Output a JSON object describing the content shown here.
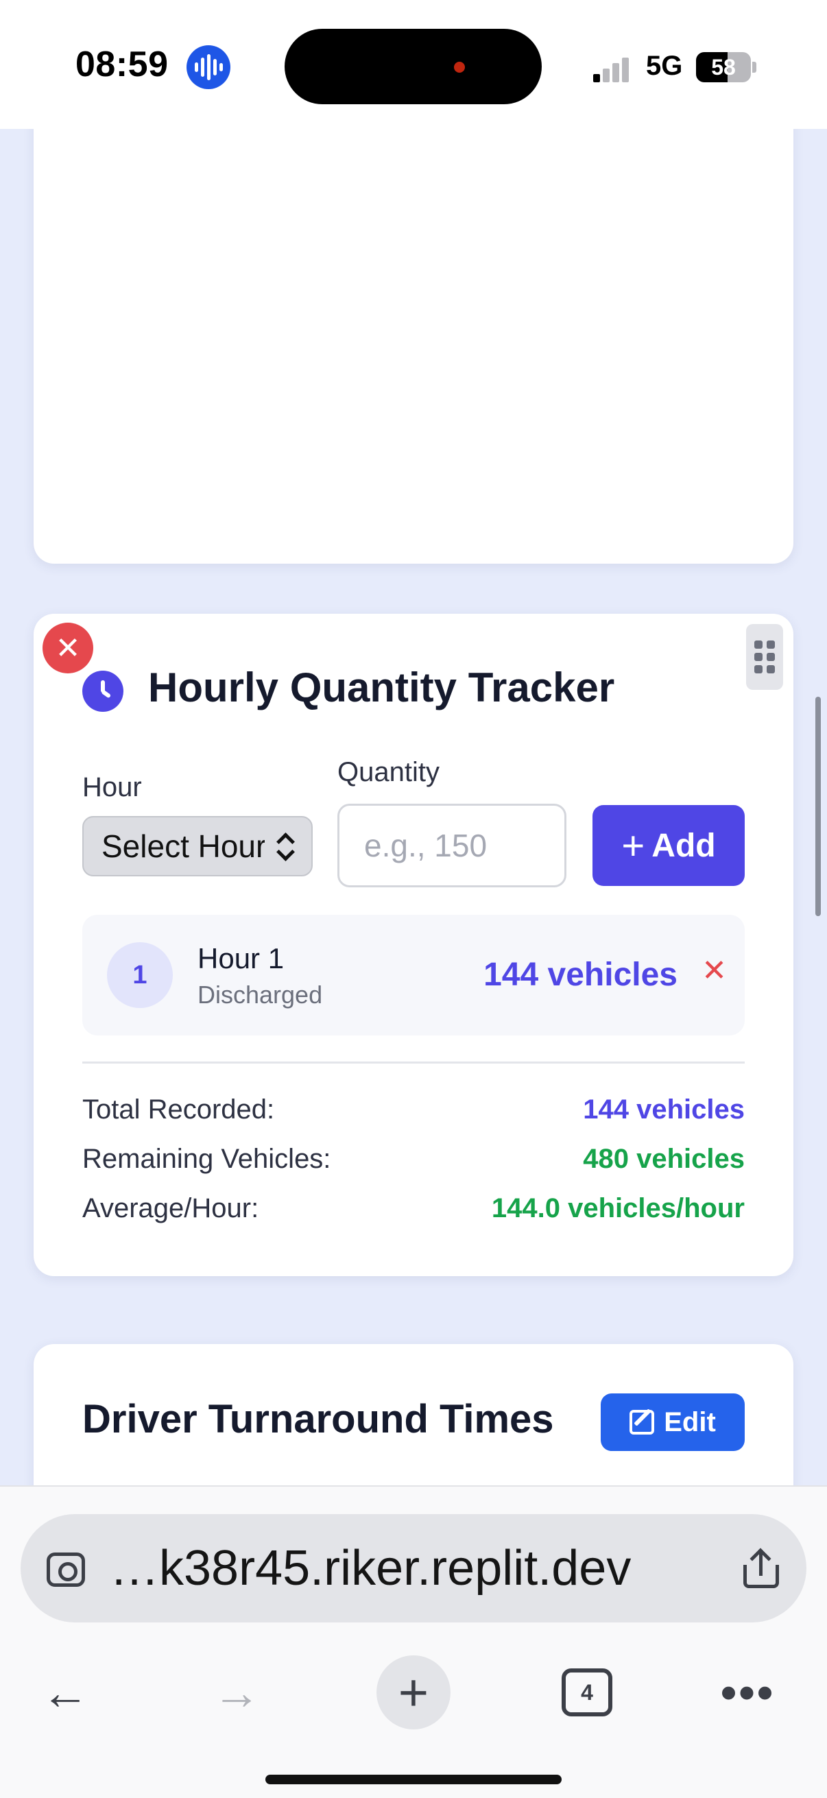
{
  "status_bar": {
    "time": "08:59",
    "network": "5G",
    "battery": "58",
    "battery_level": 0.58
  },
  "tracker": {
    "title": "Hourly Quantity Tracker",
    "hour_label": "Hour",
    "hour_select_value": "Select Hour",
    "quantity_label": "Quantity",
    "quantity_placeholder": "e.g., 150",
    "add_label": "Add",
    "entries": [
      {
        "badge": "1",
        "title": "Hour 1",
        "status": "Discharged",
        "value": "144 vehicles"
      }
    ],
    "stats": {
      "total_label": "Total Recorded:",
      "total_value": "144 vehicles",
      "remaining_label": "Remaining Vehicles:",
      "remaining_value": "480 vehicles",
      "average_label": "Average/Hour:",
      "average_value": "144.0 vehicles/hour"
    }
  },
  "driver": {
    "title": "Driver Turnaround Times",
    "edit_label": "Edit"
  },
  "browser": {
    "url": "…k38r45.riker.replit.dev",
    "tabs_count": "4"
  },
  "colors": {
    "primary": "#4f46e5",
    "success": "#16a34a",
    "danger": "#e5484d",
    "edit_blue": "#2563eb",
    "page_bg": "#e6ebfb"
  },
  "icons": {
    "remove": "close-icon",
    "drag": "drag-handle-icon",
    "clock": "clock-icon",
    "edit": "edit-icon",
    "share": "share-icon",
    "lens": "lens-icon"
  }
}
